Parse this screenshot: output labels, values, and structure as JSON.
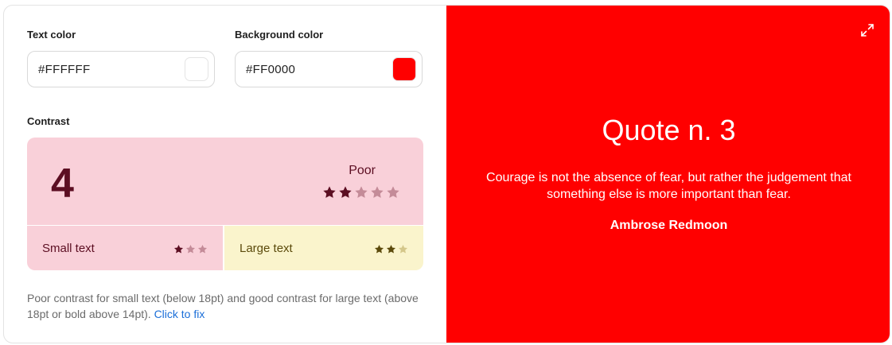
{
  "text_color": {
    "label": "Text color",
    "value": "#FFFFFF"
  },
  "background_color": {
    "label": "Background color",
    "value": "#FF0000"
  },
  "contrast": {
    "label": "Contrast",
    "score": "4",
    "rating": "Poor",
    "rating_stars": 2,
    "max_stars": 5,
    "small_text": {
      "label": "Small text",
      "stars": 1,
      "max_stars": 3
    },
    "large_text": {
      "label": "Large text",
      "stars": 2,
      "max_stars": 3
    },
    "note": "Poor contrast for small text (below 18pt) and good contrast for large text (above 18pt or bold above 14pt).",
    "fix_link": "Click to fix"
  },
  "preview": {
    "title": "Quote n. 3",
    "quote": "Courage is not the absence of fear, but rather the judgement that something else is more important than fear.",
    "author": "Ambrose Redmoon",
    "expand_icon": "expand-icon"
  },
  "colors": {
    "poor_bg": "#F9D0D9",
    "poor_fg": "#5c0e22",
    "good_bg": "#FAF4CC",
    "good_fg": "#5b4a0b"
  }
}
